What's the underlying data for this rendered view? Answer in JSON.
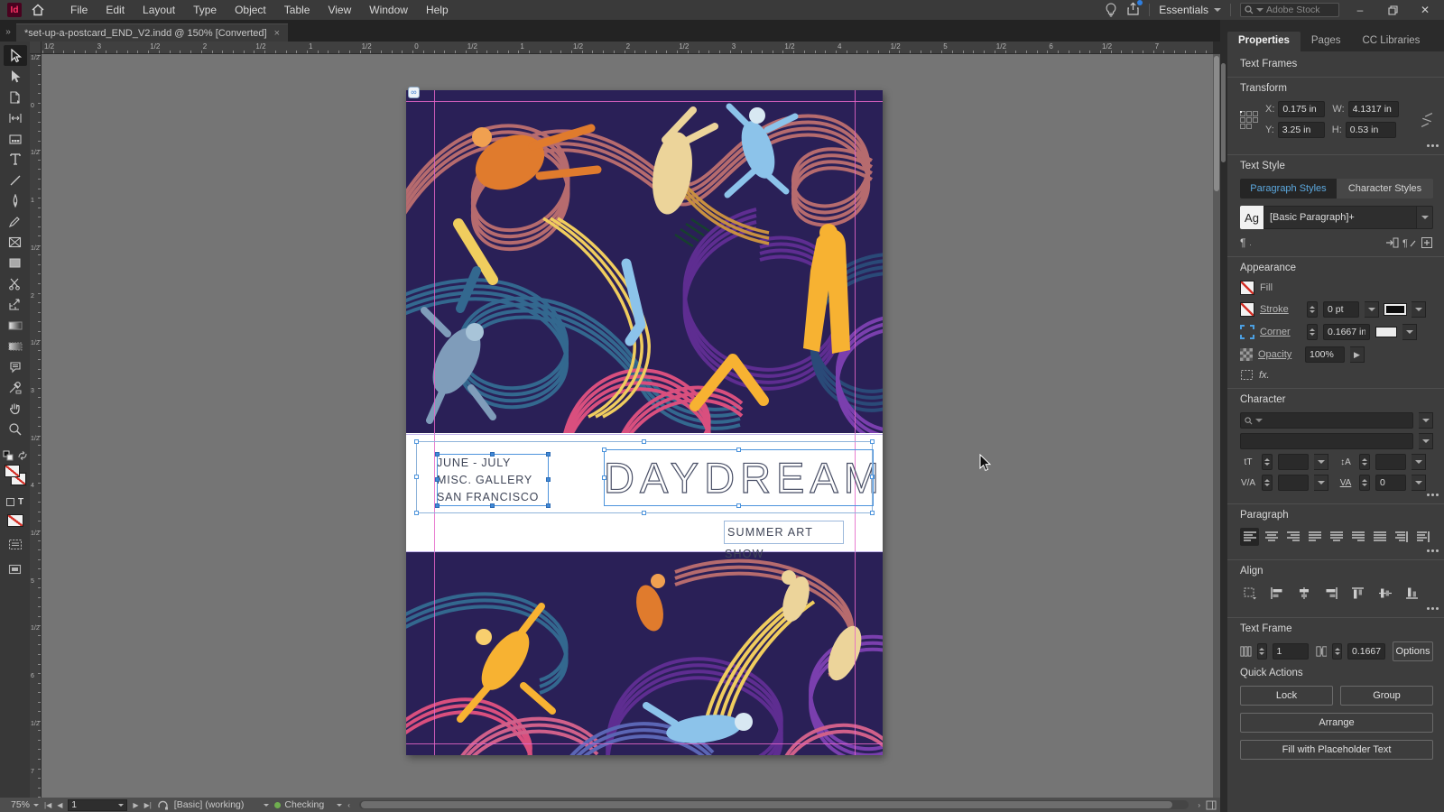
{
  "app": {
    "name": "InDesign",
    "logo_text": "Id"
  },
  "menu_bar": {
    "menus": [
      "File",
      "Edit",
      "Layout",
      "Type",
      "Object",
      "Table",
      "View",
      "Window",
      "Help"
    ],
    "workspace_label": "Essentials",
    "search_placeholder": "Adobe Stock"
  },
  "document_tab": {
    "title": "*set-up-a-postcard_END_V2.indd @ 150% [Converted]",
    "close_glyph": "×",
    "overflow_glyph": "»"
  },
  "rulers": {
    "horizontal_labels": [
      "1/2",
      "3",
      "1/2",
      "2",
      "1/2",
      "1",
      "1/2",
      "0",
      "1/2",
      "1",
      "1/2",
      "2",
      "1/2",
      "3",
      "1/2",
      "4",
      "1/2",
      "5",
      "1/2",
      "6",
      "1/2",
      "7"
    ],
    "vertical_labels": [
      "1/2",
      "0",
      "1/2",
      "1",
      "1/2",
      "2",
      "1/2",
      "3",
      "1/2",
      "4",
      "1/2",
      "5",
      "1/2",
      "6",
      "1/2",
      "7"
    ]
  },
  "toolbar": {
    "tools": [
      "selection",
      "direct-selection",
      "page",
      "gap",
      "content-collector",
      "type",
      "line",
      "pen",
      "pencil",
      "frame",
      "rectangle",
      "scissors",
      "free-transform",
      "gradient",
      "gradient-feather",
      "note",
      "eyedropper",
      "hand",
      "zoom"
    ],
    "active_tool": "selection"
  },
  "postcard": {
    "dates_line1": "JUNE - JULY",
    "dates_line2": "MISC. GALLERY",
    "dates_line3": "SAN FRANCISCO",
    "title": "DAYDREAM",
    "subtitle": "SUMMER ART SHOW"
  },
  "artwork": {
    "background": "#2a2057",
    "palette": {
      "salmon": "#b66b6e",
      "blue": "#33688f",
      "navy": "#2a4a78",
      "purple": "#5e2d91",
      "violet": "#7a3fae",
      "pink": "#d94f7e",
      "magenta": "#d0608a",
      "yellow": "#f0cd5e",
      "gold": "#c89040",
      "periwinkle": "#5b66b5",
      "orange": "#e07b2d",
      "cream": "#ecd49a",
      "sky": "#8cc3ea",
      "steel": "#7f9cba",
      "amber": "#f7b232"
    }
  },
  "properties_panel": {
    "tabs": [
      "Properties",
      "Pages",
      "CC Libraries"
    ],
    "selection_type": "Text Frames",
    "transform": {
      "title": "Transform",
      "x_label": "X:",
      "x_value": "0.175 in",
      "y_label": "Y:",
      "y_value": "3.25 in",
      "w_label": "W:",
      "w_value": "4.1317 in",
      "h_label": "H:",
      "h_value": "0.53 in"
    },
    "text_style": {
      "title": "Text Style",
      "paragraph_tab": "Paragraph Styles",
      "character_tab": "Character Styles",
      "sample_glyph": "Ag",
      "style_name": "[Basic Paragraph]+",
      "pilcrow_glyph": "¶"
    },
    "appearance": {
      "title": "Appearance",
      "fill_label": "Fill",
      "stroke_label": "Stroke",
      "stroke_weight": "0 pt",
      "corner_label": "Corner",
      "corner_value": "0.1667 in",
      "opacity_label": "Opacity",
      "opacity_value": "100%",
      "fx_glyph": "fx."
    },
    "character": {
      "title": "Character",
      "size_glyph": "tT",
      "leading_glyph": "↕A",
      "kerning_glyph": "V/A",
      "tracking_glyph": "VA",
      "tracking_value": "0"
    },
    "paragraph": {
      "title": "Paragraph"
    },
    "align": {
      "title": "Align"
    },
    "text_frame": {
      "title": "Text Frame",
      "columns_value": "1",
      "inset_value": "0.1667",
      "options_label": "Options"
    },
    "quick_actions": {
      "title": "Quick Actions",
      "lock_label": "Lock",
      "group_label": "Group",
      "arrange_label": "Arrange",
      "fill_placeholder_label": "Fill with Placeholder Text"
    }
  },
  "status_bar": {
    "zoom_level": "75%",
    "page_number": "1",
    "preset_label": "[Basic] (working)",
    "preflight_label": "Checking"
  },
  "colors": {
    "accent_blue": "#4b9fe1",
    "selection_handle": "#3f89d8",
    "guide_pink": "#e566c8",
    "guide_violet": "#b7a6e8",
    "menubar_bg": "#3a3a3a",
    "panel_bg": "#3d3d3d",
    "pasteboard": "#757575"
  }
}
